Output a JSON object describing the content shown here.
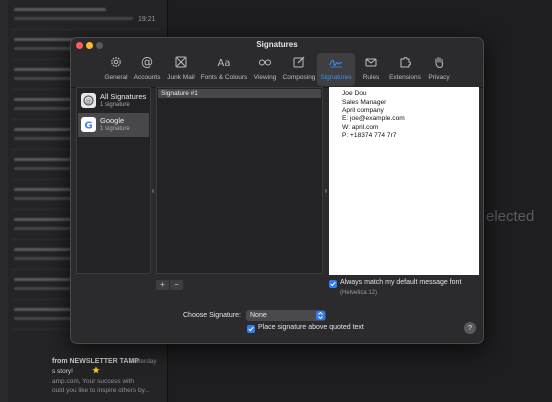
{
  "background": {
    "time": "19:21",
    "last_message": {
      "sender": "from NEWSLETTER TAMP",
      "date": "Yesterday",
      "line1": "s story! ",
      "line2": "amp.com, Your success with",
      "line3": "ould you like to inspire others by..."
    },
    "detail_placeholder": "elected"
  },
  "window": {
    "title": "Signatures",
    "toolbar": [
      {
        "id": "general",
        "label": "General",
        "icon": "gear-icon"
      },
      {
        "id": "accounts",
        "label": "Accounts",
        "icon": "at-icon"
      },
      {
        "id": "junk",
        "label": "Junk Mail",
        "icon": "junk-tray-icon"
      },
      {
        "id": "fonts",
        "label": "Fonts & Colours",
        "icon": "font-aa-icon"
      },
      {
        "id": "viewing",
        "label": "Viewing",
        "icon": "glasses-icon"
      },
      {
        "id": "composing",
        "label": "Composing",
        "icon": "compose-icon"
      },
      {
        "id": "signatures",
        "label": "Signatures",
        "icon": "signature-icon",
        "active": true
      },
      {
        "id": "rules",
        "label": "Rules",
        "icon": "envelope-rules-icon"
      },
      {
        "id": "extensions",
        "label": "Extensions",
        "icon": "puzzle-icon"
      },
      {
        "id": "privacy",
        "label": "Privacy",
        "icon": "hand-icon"
      }
    ],
    "accounts": [
      {
        "name": "All Signatures",
        "count": "1 signature",
        "icon": "all-signatures-icon"
      },
      {
        "name": "Google",
        "count": "1 signature",
        "icon": "google-icon",
        "selected": true
      }
    ],
    "signatures": [
      {
        "name": "Signature #1"
      }
    ],
    "preview_lines": [
      "Joe Dou",
      "Sales Manager",
      "April company",
      "E: joe@example.com",
      "W: april.com",
      "P: +18374 774 7r7"
    ],
    "add_label": "+",
    "remove_label": "−",
    "match_font_label": "Always match my default message font",
    "match_font_checked": true,
    "font_hint": "(Helvetica 12)",
    "choose_signature_label": "Choose Signature:",
    "choose_signature_value": "None",
    "place_above_label": "Place signature above quoted text",
    "place_above_checked": true,
    "help_label": "?"
  },
  "colors": {
    "accent": "#2f7bf5",
    "active_tab_text": "#3a8ff5",
    "close": "#ff5f57",
    "minimize": "#febc2e"
  }
}
